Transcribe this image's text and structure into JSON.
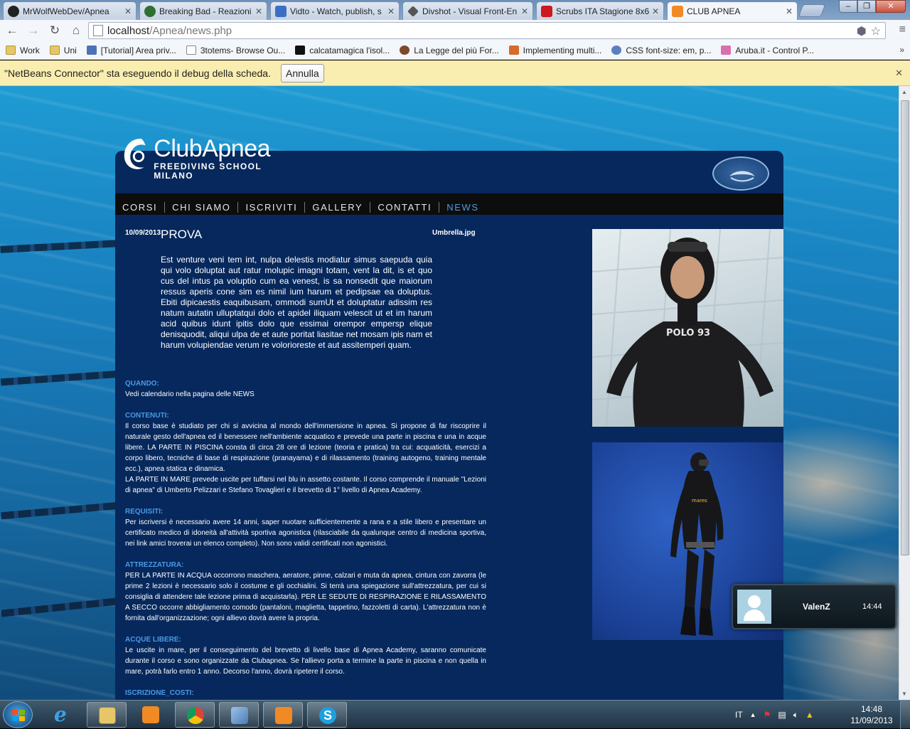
{
  "browser": {
    "tabs": [
      {
        "label": "MrWolfWebDev/Apnea",
        "icon": "github-icon",
        "color": "#222222"
      },
      {
        "label": "Breaking Bad - Reazioni",
        "icon": "site-icon",
        "color": "#2f6f2f"
      },
      {
        "label": "Vidto - Watch, publish, s",
        "icon": "vidto-icon",
        "color": "#3a6fc4"
      },
      {
        "label": "Divshot - Visual Front-En",
        "icon": "divshot-icon",
        "color": "#555555"
      },
      {
        "label": "Scrubs ITA Stagione 8x6",
        "icon": "youtube-icon",
        "color": "#cc181e"
      },
      {
        "label": "CLUB APNEA",
        "icon": "xampp-icon",
        "color": "#f08a24"
      }
    ],
    "url_host": "localhost",
    "url_path": "/Apnea/news.php",
    "bookmarks": [
      {
        "label": "Work",
        "icon": "folder-icon"
      },
      {
        "label": "Uni",
        "icon": "folder-icon"
      },
      {
        "label": "[Tutorial] Area priv...",
        "icon": "site-icon"
      },
      {
        "label": "3totems- Browse Ou...",
        "icon": "page-icon"
      },
      {
        "label": "calcatamagica l'isol...",
        "icon": "site-icon"
      },
      {
        "label": "La Legge del più For...",
        "icon": "site-icon"
      },
      {
        "label": "Implementing multi...",
        "icon": "site-icon"
      },
      {
        "label": "CSS font-size: em, p...",
        "icon": "site-icon"
      },
      {
        "label": "Aruba.it - Control P...",
        "icon": "site-icon"
      }
    ],
    "infobar": {
      "message": "\"NetBeans Connector\" sta eseguendo il debug della scheda.",
      "button": "Annulla"
    }
  },
  "site": {
    "logo_title": "ClubApnea",
    "logo_subtitle": "FREEDIVING SCHOOL MILANO",
    "nav": [
      "CORSI",
      "CHI SIAMO",
      "ISCRIVITI",
      "GALLERY",
      "CONTATTI",
      "NEWS"
    ],
    "active_nav": "NEWS",
    "article": {
      "date": "10/09/2013",
      "title": "PROVA",
      "image_name": "Umbrella.jpg",
      "lead": "Est venture veni tem int, nulpa delestis modiatur simus saepuda quia qui volo doluptat aut ratur molupic imagni totam, vent la dit, is et quo cus del intus pa voluptio cum ea venest, is sa nonsedit que maiorum ressus aperis cone sim es nimil ium harum et pedipsae ea doluptus. Ebiti dipicaestis eaquibusam, ommodi sumUt et doluptatur adissim res natum autatin ulluptatqui dolo et apidel iliquam velescit ut et im harum acid quibus idunt ipitis dolo que essimai orempor empersp elique denisquodit, aliqui ulpa de et aute poritat liasitae net mosam ipis nam et harum volupiendae verum re volorioreste et aut assitemperi quam."
    },
    "sections": [
      {
        "heading": "QUANDO:",
        "body": "Vedi calendario nella pagina delle NEWS"
      },
      {
        "heading": "CONTENUTI:",
        "body": "Il corso base è studiato per chi si avvicina al mondo dell'immersione in apnea. Si propone di far riscoprire il naturale gesto dell'apnea ed il benessere nell'ambiente acquatico e prevede una parte in piscina e una in acque libere. LA PARTE IN PISCINA consta di circa 28 ore di lezione (teoria e pratica) tra cui: acquaticità, esercizi a corpo libero, tecniche di base di respirazione (pranayama) e di rilassamento (training autogeno, training mentale ecc.), apnea statica e dinamica.\nLA PARTE IN MARE prevede uscite per tuffarsi nel blu in assetto costante. Il corso comprende il manuale \"Lezioni di apnea\" di Umberto Pelizzari e Stefano Tovaglieri e il brevetto di 1° livello di Apnea Academy."
      },
      {
        "heading": "REQUISITI:",
        "body": "Per iscriversi è necessario avere 14 anni, saper nuotare sufficientemente a rana e a stile libero e presentare un certificato medico di idoneità all'attività sportiva agonistica (rilasciabile da qualunque centro di medicina sportiva, nei link amici troverai un elenco completo). Non sono validi certificati non agonistici."
      },
      {
        "heading": "ATTREZZATURA:",
        "body": "PER LA PARTE IN ACQUA occorrono maschera, aeratore, pinne, calzari e muta da apnea, cintura con zavorra (le prime 2 lezioni è necessario solo il costume e gli occhialini. Si terrà una spiegazione sull'attrezzatura, per cui si consiglia di attendere tale lezione prima di acquistarla). PER LE SEDUTE DI RESPIRAZIONE E RILASSAMENTO A SECCO occorre abbigliamento comodo (pantaloni, maglietta, tappetino, fazzoletti di carta). L'attrezzatura non è fornita dall'organizzazione; ogni allievo dovrà avere la propria."
      },
      {
        "heading": "ACQUE LIBERE:",
        "body": "Le uscite in mare, per il conseguimento del brevetto di livello base di Apnea Academy, saranno comunicate durante il corso e sono organizzate da Clubapnea. Se l'allievo porta a termine la parte in piscina e non quella in mare, potrà farlo entro 1 anno. Decorso l'anno, dovrà ripetere il corso."
      },
      {
        "heading": "ISCRIZIONE_COSTI:",
        "body": ""
      }
    ],
    "accent_color": "#4a9be6",
    "panel_color": "#06285c"
  },
  "skype_notification": {
    "name": "ValenZ",
    "time": "14:44"
  },
  "taskbar": {
    "apps": [
      "ie-icon",
      "explorer-icon",
      "media-player-icon",
      "chrome-icon",
      "virtualbox-icon",
      "xampp-icon",
      "skype-icon"
    ],
    "language": "IT",
    "time": "14:48",
    "date": "11/09/2013"
  }
}
